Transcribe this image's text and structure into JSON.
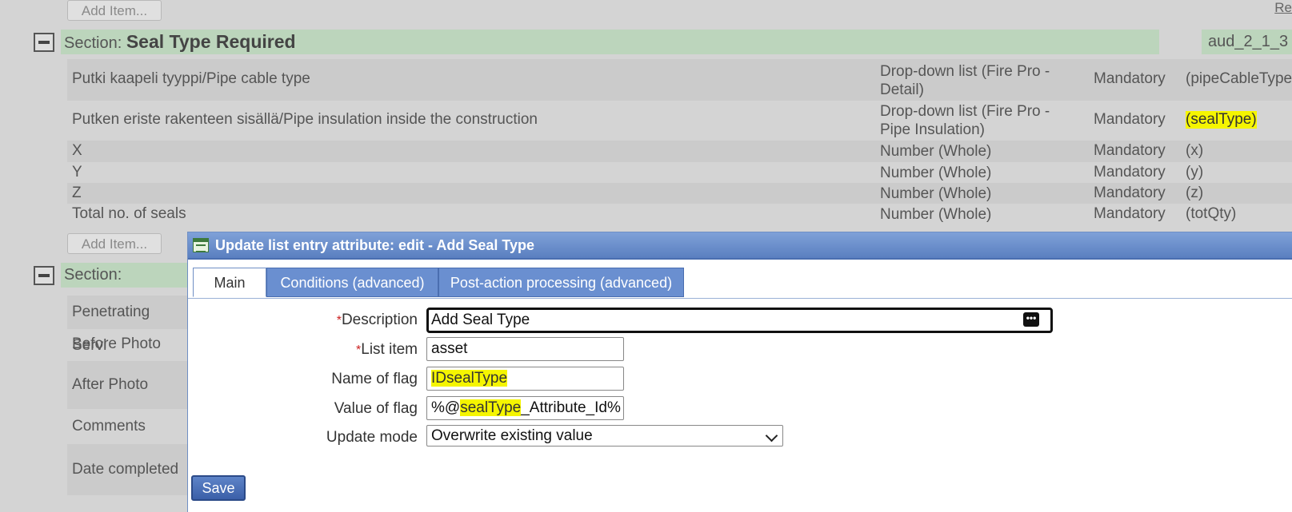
{
  "background": {
    "add_item_label": "Add Item...",
    "top_right_link": "Re",
    "section1": {
      "prefix": "Section:",
      "name": "Seal Type Required",
      "code": "aud_2_1_3"
    },
    "rows": [
      {
        "label": "Putki kaapeli tyyppi/Pipe cable type",
        "type_line1": "Drop-down list (Fire Pro -",
        "type_line2": "Detail)",
        "mandatory": "Mandatory",
        "field": "(pipeCableType)"
      },
      {
        "label": "Putken eriste rakenteen sisällä/Pipe insulation inside the construction",
        "type_line1": "Drop-down list (Fire Pro -",
        "type_line2": "Pipe Insulation)",
        "mandatory": "Mandatory",
        "field": "(sealType)"
      },
      {
        "label": "X",
        "type_line1": "Number (Whole)",
        "mandatory": "Mandatory",
        "field": "(x)"
      },
      {
        "label": "Y",
        "type_line1": "Number (Whole)",
        "mandatory": "Mandatory",
        "field": "(y)"
      },
      {
        "label": "Z",
        "type_line1": "Number (Whole)",
        "mandatory": "Mandatory",
        "field": "(z)"
      },
      {
        "label": "Total no. of seals",
        "type_line1": "Number (Whole)",
        "mandatory": "Mandatory",
        "field": "(totQty)"
      }
    ],
    "section2": {
      "prefix": "Section:",
      "rows": [
        "Penetrating Servi",
        "Before Photo",
        "After Photo",
        "Comments",
        "Date completed"
      ]
    }
  },
  "dialog": {
    "title": "Update list entry attribute: edit - Add Seal Type",
    "tabs": [
      "Main",
      "Conditions (advanced)",
      "Post-action processing (advanced)"
    ],
    "fields": {
      "description": {
        "label": "Description",
        "value": "Add Seal Type"
      },
      "list_item": {
        "label": "List item",
        "value": "asset"
      },
      "name_of_flag": {
        "label": "Name of flag",
        "value": "IDsealType"
      },
      "value_of_flag": {
        "label": "Value of flag",
        "value_prefix": "%@",
        "value_highlight": "sealType",
        "value_suffix": "_Attribute_Id%"
      },
      "update_mode": {
        "label": "Update mode",
        "value": "Overwrite existing value"
      }
    },
    "required_marker": "*",
    "save_label": "Save"
  },
  "colors": {
    "highlight": "#f5f500",
    "section_header": "#bcd5bc",
    "dialog_title": "#5a7fc0"
  },
  "icons": [
    "collapse-icon",
    "list-icon",
    "ellipsis-icon",
    "chevron-down-icon"
  ]
}
